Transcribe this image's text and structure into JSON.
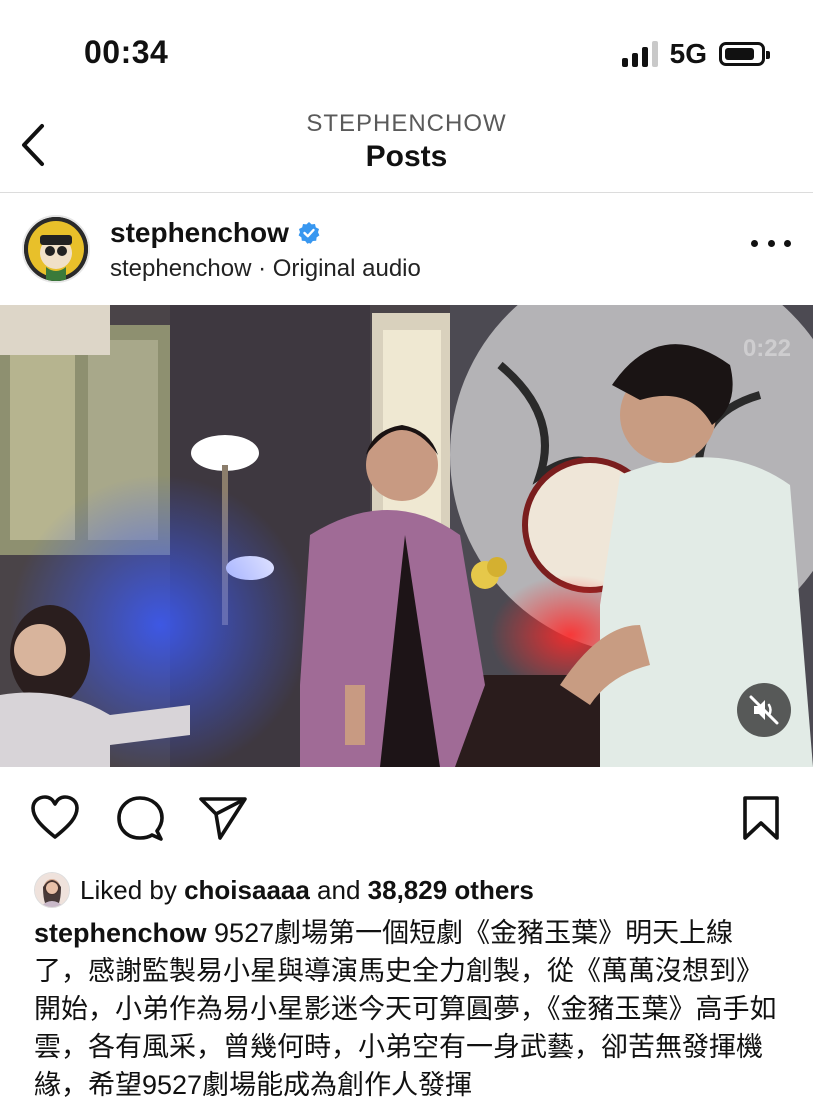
{
  "status_bar": {
    "time": "00:34",
    "network": "5G"
  },
  "header": {
    "subtitle": "STEPHENCHOW",
    "title": "Posts"
  },
  "post": {
    "username": "stephenchow",
    "audio": "stephenchow · Original audio",
    "media_watermark": "0:22",
    "liked_by_prefix": "Liked by ",
    "liked_by_user": "choisaaaa",
    "liked_by_conjunction": " and ",
    "liked_by_others": "38,829 others",
    "caption_user": "stephenchow",
    "caption_text": " 9527劇場第一個短劇《金豬玉葉》明天上線了，感謝監製易小星與導演馬史全力創製，從《萬萬沒想到》開始，小弟作為易小星影迷今天可算圓夢，《金豬玉葉》高手如雲，各有風采，曾幾何時，小弟空有一身武藝，卻苦無發揮機緣，希望9527劇場能成為創作人發揮"
  },
  "icons": {
    "back": "chevron-left-icon",
    "verified": "verified-badge-icon",
    "more": "more-horizontal-icon",
    "mute": "speaker-muted-icon",
    "like": "heart-icon",
    "comment": "comment-bubble-icon",
    "share": "paper-plane-icon",
    "save": "bookmark-icon"
  },
  "colors": {
    "verified_blue": "#3897f0",
    "divider": "#dcdcdc",
    "text": "#111111"
  }
}
